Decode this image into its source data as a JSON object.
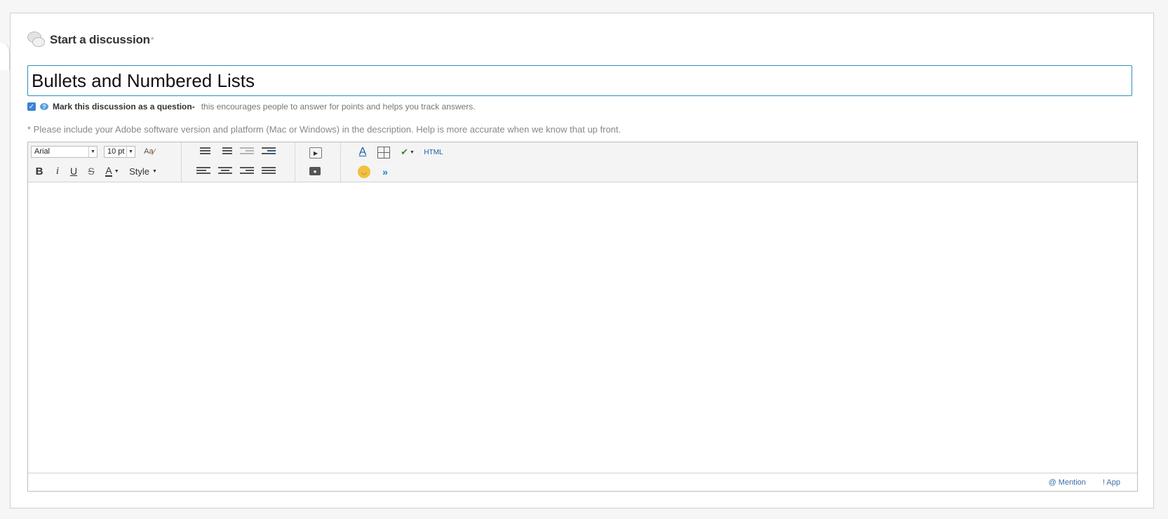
{
  "header": {
    "title": "Start a discussion",
    "required_mark": "*"
  },
  "subject": {
    "value": "Bullets and Numbered Lists"
  },
  "question": {
    "checked": true,
    "label": "Mark this discussion as a question-",
    "description": "this encourages people to answer for points and helps you track answers."
  },
  "note": "* Please include your Adobe software version and platform (Mac or Windows) in the description. Help is more accurate when we know that up front.",
  "toolbar": {
    "font": "Arial",
    "size": "10 pt",
    "style_label": "Style",
    "html_label": "HTML",
    "icons": [
      "clear-format-icon",
      "bullet-list-icon",
      "numbered-list-icon",
      "outdent-icon",
      "indent-icon",
      "media-icon",
      "image-icon",
      "link-icon",
      "table-icon",
      "spellcheck-icon",
      "emoji-icon",
      "more-icon"
    ]
  },
  "footer": {
    "mention": "@ Mention",
    "app": "! App"
  },
  "colors": {
    "accent": "#2f8fbf",
    "link": "#3a6ea5",
    "checkbox": "#3b82d6"
  }
}
